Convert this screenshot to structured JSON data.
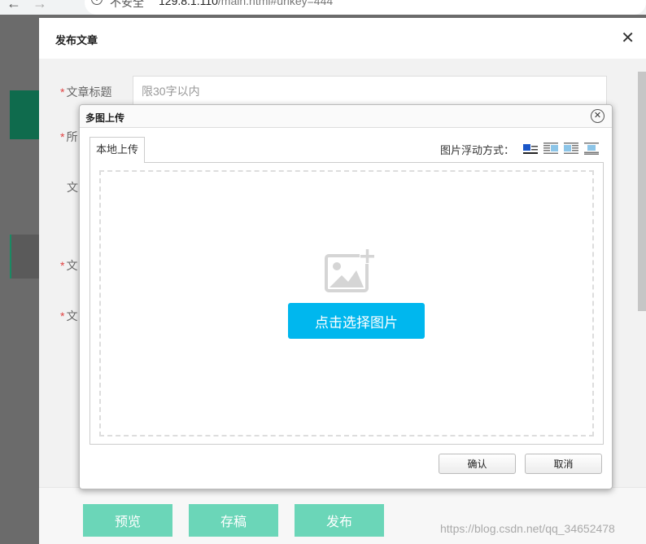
{
  "browser": {
    "security": "不安全",
    "url_host": "129.8.1.110",
    "url_path": "/main.html#urlkey=444"
  },
  "modal": {
    "title": "发布文章",
    "form": {
      "title_label": "文章标题",
      "title_placeholder": "限30字以内",
      "label_2": "所",
      "label_3": "文",
      "label_4": "文",
      "label_5": "文"
    },
    "footer": {
      "preview": "预览",
      "draft": "存稿",
      "publish": "发布",
      "watermark": "https://blog.csdn.net/qq_34652478"
    }
  },
  "upload_dialog": {
    "title": "多图上传",
    "tab_local": "本地上传",
    "float_label": "图片浮动方式：",
    "float_options": [
      "float-left-icon",
      "float-right-icon",
      "float-none-icon",
      "float-center-icon"
    ],
    "choose_button": "点击选择图片",
    "confirm": "确认",
    "cancel": "取消"
  },
  "colors": {
    "accent_blue": "#00b7ee",
    "footer_green": "#6bd6b8",
    "required_red": "#e04343"
  }
}
